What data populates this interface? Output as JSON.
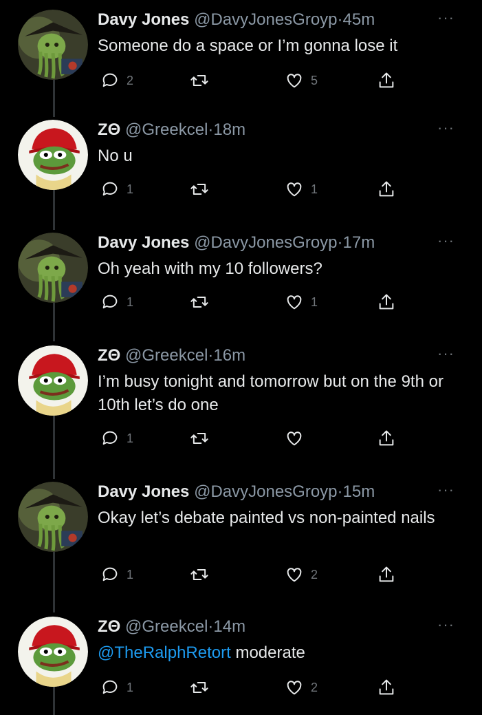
{
  "tweets": [
    {
      "author": "davy",
      "name": "Davy Jones",
      "handle": "@DavyJonesGroyp",
      "sep": "·",
      "time": "45m",
      "more": "···",
      "text": "Someone do a space or I’m gonna lose it",
      "mention": "",
      "replies": "2",
      "retweets": "",
      "likes": "5"
    },
    {
      "author": "zo",
      "name": "ZΘ",
      "handle": "@Greekcel",
      "sep": "·",
      "time": "18m",
      "more": "···",
      "text": "No u",
      "mention": "",
      "replies": "1",
      "retweets": "",
      "likes": "1"
    },
    {
      "author": "davy",
      "name": "Davy Jones",
      "handle": "@DavyJonesGroyp",
      "sep": "·",
      "time": "17m",
      "more": "···",
      "text": "Oh yeah with my 10 followers?",
      "mention": "",
      "replies": "1",
      "retweets": "",
      "likes": "1"
    },
    {
      "author": "zo",
      "name": "ZΘ",
      "handle": "@Greekcel",
      "sep": "·",
      "time": "16m",
      "more": "···",
      "text": "I’m busy tonight and tomorrow but on the 9th or 10th let’s do one",
      "mention": "",
      "replies": "1",
      "retweets": "",
      "likes": ""
    },
    {
      "author": "davy",
      "name": "Davy Jones",
      "handle": "@DavyJonesGroyp",
      "sep": "·",
      "time": "15m",
      "more": "···",
      "text": "Okay let’s debate painted vs non-painted nails",
      "mention": "",
      "replies": "1",
      "retweets": "",
      "likes": "2"
    },
    {
      "author": "zo",
      "name": "ZΘ",
      "handle": "@Greekcel",
      "sep": "·",
      "time": "14m",
      "more": "···",
      "text": " moderate",
      "mention": "@TheRalphRetort",
      "replies": "1",
      "retweets": "",
      "likes": "2"
    }
  ],
  "colors": {
    "background": "#000000",
    "text": "#e7e9ea",
    "secondary": "#8b98a5",
    "icon": "#71767b",
    "mention": "#1d9bf0",
    "thread_line": "#2f3336"
  },
  "icons": {
    "reply": "reply-icon",
    "retweet": "retweet-icon",
    "like": "heart-icon",
    "share": "share-icon",
    "more": "more-icon"
  }
}
